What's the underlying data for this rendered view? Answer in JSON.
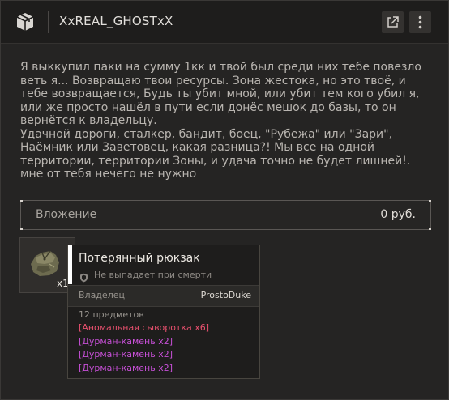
{
  "header": {
    "title": "XxREAL_GHOSTxX",
    "logo_icon": "package-box-icon",
    "open_button_icon": "external-link-icon",
    "more_button_icon": "vertical-dots-icon"
  },
  "message": {
    "text": "Я выккупил паки на сумму 1кк и твой был среди них тебе повезло веть я... Возвращаю твои ресурсы. Зона жестока, но это твоё, и тебе возвращается, Будь ты убит мной, или убит тем кого убил я, или же просто нашёл в пути если донёс мешок до базы, то он вернётся к владельцу.\nУдачной дороги, сталкер, бандит, боец, \"Рубежа\" или \"Зари\", Наёмник или Заветовец, какая разница?! Мы все на одной территории, территории Зоны, и удача точно не будет лишней!. мне от тебя нечего не нужно"
  },
  "attachment": {
    "label": "Вложение",
    "value": "0 руб."
  },
  "item": {
    "icon": "backpack-icon",
    "count": "x1"
  },
  "tooltip": {
    "title": "Потерянный рюкзак",
    "no_drop_icon": "shield-icon",
    "no_drop_text": "Не выпадает при смерти",
    "owner_label": "Владелец",
    "owner_value": "ProstoDuke",
    "contents_count": "12 предметов",
    "contents": [
      {
        "text": "[Аномальная сыворотка x6]",
        "color": "#e8506e"
      },
      {
        "text": "[Дурман-камень x2]",
        "color": "#c850d8"
      },
      {
        "text": "[Дурман-камень x2]",
        "color": "#c850d8"
      },
      {
        "text": "[Дурман-камень x2]",
        "color": "#c850d8"
      }
    ]
  },
  "colors": {
    "accent_white": "#ffffff",
    "rarity_red": "#e8506e",
    "rarity_purple": "#c850d8"
  }
}
